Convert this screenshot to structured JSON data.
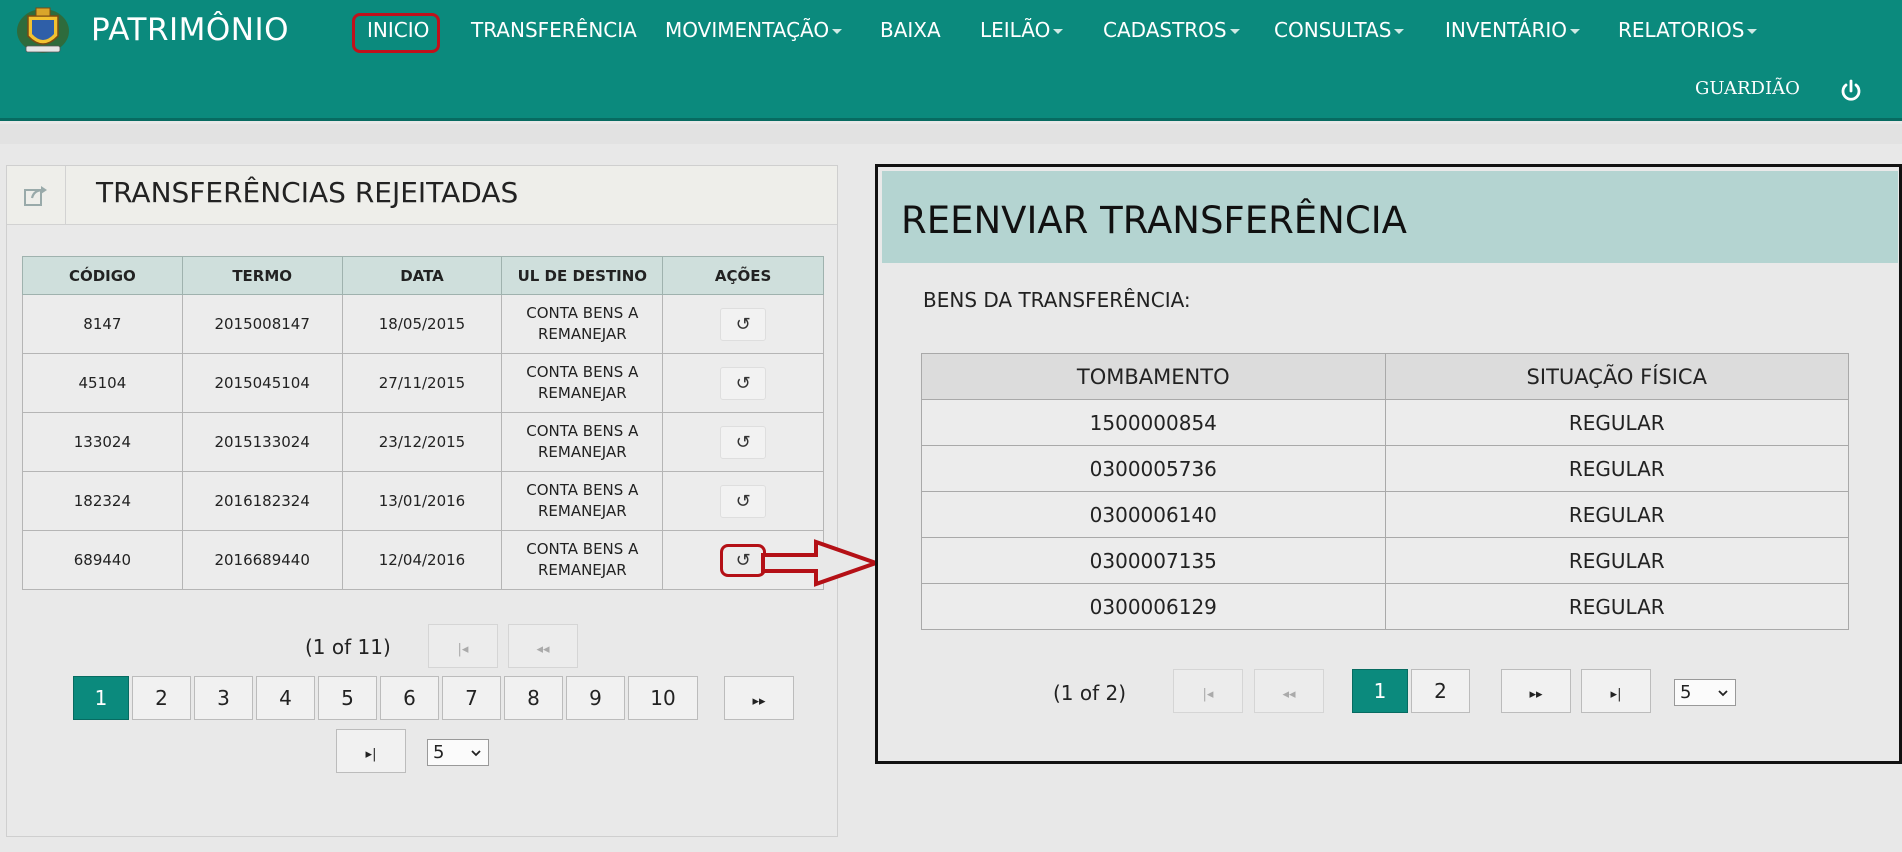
{
  "brand": "PATRIMÔNIO",
  "nav": [
    {
      "label": "INICIO"
    },
    {
      "label": "TRANSFERÊNCIA"
    },
    {
      "label": "MOVIMENTAÇÃO"
    },
    {
      "label": "BAIXA"
    },
    {
      "label": "LEILÃO"
    },
    {
      "label": "CADASTROS"
    },
    {
      "label": "CONSULTAS"
    },
    {
      "label": "INVENTÁRIO"
    },
    {
      "label": "RELATORIOS"
    }
  ],
  "user": "GUARDIÃO",
  "left": {
    "title": "TRANSFERÊNCIAS REJEITADAS",
    "columns": [
      "CÓDIGO",
      "TERMO",
      "DATA",
      "UL DE DESTINO",
      "AÇÕES"
    ],
    "rows": [
      {
        "codigo": "8147",
        "termo": "2015008147",
        "data": "18/05/2015",
        "ul1": "CONTA BENS A",
        "ul2": "REMANEJAR",
        "action": "↺"
      },
      {
        "codigo": "45104",
        "termo": "2015045104",
        "data": "27/11/2015",
        "ul1": "CONTA BENS A",
        "ul2": "REMANEJAR",
        "action": "↺"
      },
      {
        "codigo": "133024",
        "termo": "2015133024",
        "data": "23/12/2015",
        "ul1": "CONTA BENS A",
        "ul2": "REMANEJAR",
        "action": "↺"
      },
      {
        "codigo": "182324",
        "termo": "2016182324",
        "data": "13/01/2016",
        "ul1": "CONTA BENS A",
        "ul2": "REMANEJAR",
        "action": "↺"
      },
      {
        "codigo": "689440",
        "termo": "2016689440",
        "data": "12/04/2016",
        "ul1": "CONTA BENS A",
        "ul2": "REMANEJAR",
        "action": "↺"
      }
    ],
    "pagination": {
      "summary": "(1 of 11)",
      "pages": [
        "1",
        "2",
        "3",
        "4",
        "5",
        "6",
        "7",
        "8",
        "9",
        "10"
      ],
      "active_page": "1",
      "first": "|◂",
      "prev": "◂◂",
      "next": "▸▸",
      "last": "▸|",
      "rows_per_page": "5"
    }
  },
  "right": {
    "title": "REENVIAR TRANSFERÊNCIA",
    "subtitle": "BENS DA TRANSFERÊNCIA:",
    "columns": [
      "TOMBAMENTO",
      "SITUAÇÃO FÍSICA"
    ],
    "rows": [
      {
        "tombamento": "1500000854",
        "situacao": "REGULAR"
      },
      {
        "tombamento": "0300005736",
        "situacao": "REGULAR"
      },
      {
        "tombamento": "0300006140",
        "situacao": "REGULAR"
      },
      {
        "tombamento": "0300007135",
        "situacao": "REGULAR"
      },
      {
        "tombamento": "0300006129",
        "situacao": "REGULAR"
      }
    ],
    "pagination": {
      "summary": "(1 of 2)",
      "pages": [
        "1",
        "2"
      ],
      "active_page": "1",
      "first": "|◂",
      "prev": "◂◂",
      "next": "▸▸",
      "last": "▸|",
      "rows_per_page": "5"
    }
  },
  "colors": {
    "navbar": "#0b8a7d",
    "highlight": "#c0111b",
    "table_header_left": "#cfdfdc",
    "panel_header_right": "#b4d4d1"
  },
  "icons": {
    "logo": "coat-of-arms-icon",
    "power": "power-icon",
    "share": "share-icon",
    "resend": "refresh-icon"
  }
}
